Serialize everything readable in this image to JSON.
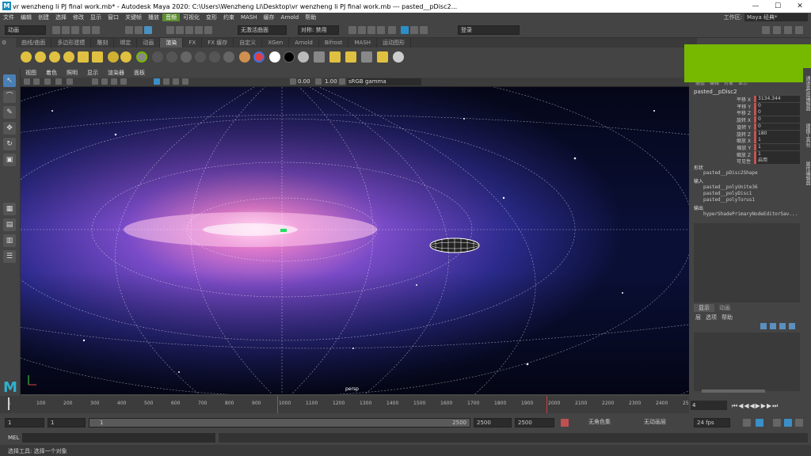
{
  "window": {
    "title": "vr wenzheng li PJ final work.mb* - Autodesk Maya 2020: C:\\Users\\Wenzheng Li\\Desktop\\vr wenzheng li PJ final work.mb   ---   pasted__pDisc2...",
    "logo": "M"
  },
  "menubar": [
    "文件",
    "编辑",
    "创建",
    "选择",
    "修改",
    "显示",
    "窗口",
    "关键帧",
    "播放",
    "音频",
    "可视化",
    "变形",
    "约束",
    "MASH",
    "缓存",
    "Arnold",
    "帮助"
  ],
  "menubar_highlight": "音频",
  "workspace": {
    "label": "工作区:",
    "value": "Maya 经典*"
  },
  "statusline": {
    "mode": "动画",
    "no_live": "无激活曲面",
    "symmetry": "对称: 禁用",
    "login": "登录"
  },
  "shelf_tabs": [
    "曲线/曲面",
    "多边形建模",
    "雕刻",
    "绑定",
    "动画",
    "渲染",
    "FX",
    "FX 缓存",
    "自定义",
    "XGen",
    "Arnold",
    "Bifrost",
    "MASH",
    "运动图形"
  ],
  "shelf_active": "渲染",
  "viewport_menu": [
    "视图",
    "着色",
    "照明",
    "显示",
    "渲染器",
    "面板"
  ],
  "viewport_toolbar": {
    "exposure": "0.00",
    "gamma": "1.00",
    "colorspace": "sRGB gamma"
  },
  "camera_label": "persp",
  "channel_box": {
    "menu": [
      "通道",
      "编辑",
      "对象",
      "显示"
    ],
    "object_name": "pasted__pDisc2",
    "attributes": [
      {
        "label": "平移 X",
        "value": "3134.344"
      },
      {
        "label": "平移 Y",
        "value": "0"
      },
      {
        "label": "平移 Z",
        "value": "0"
      },
      {
        "label": "旋转 X",
        "value": "0"
      },
      {
        "label": "旋转 Y",
        "value": "0"
      },
      {
        "label": "旋转 Z",
        "value": "180"
      },
      {
        "label": "缩放 X",
        "value": "1"
      },
      {
        "label": "缩放 Y",
        "value": "1"
      },
      {
        "label": "缩放 Z",
        "value": "1"
      },
      {
        "label": "可见性",
        "value": "启用"
      }
    ],
    "shapes_label": "形状",
    "shape_node": "pasted__pDisc2Shape",
    "inputs_label": "输入",
    "inputs": [
      "pasted__polyUnite36",
      "pasted__polyDisc1",
      "pasted__polyTorus1"
    ],
    "outputs_label": "输出",
    "outputs": [
      "hyperShadePrimaryNodeEditorSav..."
    ]
  },
  "layer_editor": {
    "tabs": [
      "显示",
      "动画"
    ],
    "menu": [
      "层",
      "选项",
      "帮助"
    ]
  },
  "side_tabs": [
    "通道盒/层编辑器",
    "建模工具包",
    "属性编辑器"
  ],
  "timeline": {
    "ticks": [
      "1",
      "100",
      "200",
      "300",
      "400",
      "500",
      "600",
      "700",
      "800",
      "900",
      "1000",
      "1100",
      "1200",
      "1300",
      "1400",
      "1500",
      "1600",
      "1700",
      "1800",
      "1900",
      "2000",
      "2100",
      "2200",
      "2300",
      "2400",
      "25"
    ],
    "current_frame": "4"
  },
  "range": {
    "start": "1",
    "start2": "1",
    "range_slider_label": "1",
    "range_end": "2500",
    "end1": "2500",
    "end2": "2500",
    "char_set": "无角色集",
    "anim_layer": "无动画层",
    "fps": "24 fps"
  },
  "mel": {
    "label": "MEL"
  },
  "help_line": "选择工具: 选择一个对象"
}
